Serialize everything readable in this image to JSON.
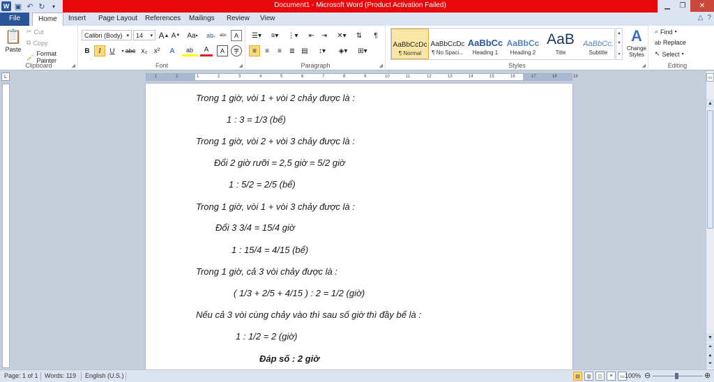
{
  "window": {
    "title": "Document1 - Microsoft Word (Product Activation Failed)",
    "controls": [
      "minimize",
      "restore",
      "close"
    ]
  },
  "qat": {
    "icons": [
      "word-icon",
      "save-icon",
      "undo-icon",
      "redo-icon",
      "customize-icon"
    ]
  },
  "tabs": [
    {
      "label": "File"
    },
    {
      "label": "Home"
    },
    {
      "label": "Insert"
    },
    {
      "label": "Page Layout"
    },
    {
      "label": "References"
    },
    {
      "label": "Mailings"
    },
    {
      "label": "Review"
    },
    {
      "label": "View"
    }
  ],
  "clipboard": {
    "paste": "Paste",
    "cut": "Cut",
    "copy": "Copy",
    "format_painter": "Format Painter",
    "label": "Clipboard"
  },
  "font": {
    "name": "Calibri (Body)",
    "size": "14",
    "label": "Font",
    "bold": "B",
    "italic": "I",
    "underline": "U",
    "strike": "abc",
    "subscript": "x₂",
    "superscript": "x²",
    "grow": "A",
    "shrink": "A",
    "case": "Aa",
    "highlight": "ab",
    "color": "A"
  },
  "paragraph": {
    "label": "Paragraph"
  },
  "styles": {
    "label": "Styles",
    "items": [
      {
        "sample": "AaBbCcDc",
        "name": "¶ Normal"
      },
      {
        "sample": "AaBbCcDc",
        "name": "¶ No Spaci..."
      },
      {
        "sample": "AaBbCc",
        "name": "Heading 1"
      },
      {
        "sample": "AaBbCc",
        "name": "Heading 2"
      },
      {
        "sample": "AaB",
        "name": "Title"
      },
      {
        "sample": "AaBbCc.",
        "name": "Subtitle"
      }
    ],
    "change": "Change Styles"
  },
  "editing": {
    "label": "Editing",
    "find": "Find",
    "replace": "Replace",
    "select": "Select"
  },
  "document": {
    "lines": [
      "Trong 1 giờ, vòi 1 + vòi 2 chảy được là :",
      "1 : 3 = 1/3 (bể)",
      "Trong 1 giờ, vòi 2 + vòi 3 chảy được là :",
      "Đổi 2 giờ rưỡi = 2,5 giờ = 5/2 giờ",
      "1 : 5/2 = 2/5 (bể)",
      "Trong 1 giờ, vòi 1 + vòi 3 chảy được là :",
      "Đổi 3 3/4 = 15/4 giờ",
      "1 : 15/4 = 4/15 (bể)",
      "Trong 1 giờ, cả 3 vòi chảy được là :",
      "( 1/3 + 2/5 + 4/15 ) : 2 = 1/2 (giờ)",
      "Nếu cả 3 vòi cùng chảy vào thì sau số giờ thì đầy bể là :",
      "1 : 1/2 = 2 (giờ)",
      "Đáp số : 2 giờ"
    ]
  },
  "status": {
    "page": "Page: 1 of 1",
    "words": "Words: 119",
    "language": "English (U.S.)",
    "zoom": "100%"
  },
  "ruler_ticks": [
    "1",
    "2",
    "1",
    "2",
    "3",
    "4",
    "5",
    "6",
    "7",
    "8",
    "9",
    "10",
    "11",
    "12",
    "13",
    "14",
    "15",
    "16",
    "17",
    "18",
    "19"
  ]
}
